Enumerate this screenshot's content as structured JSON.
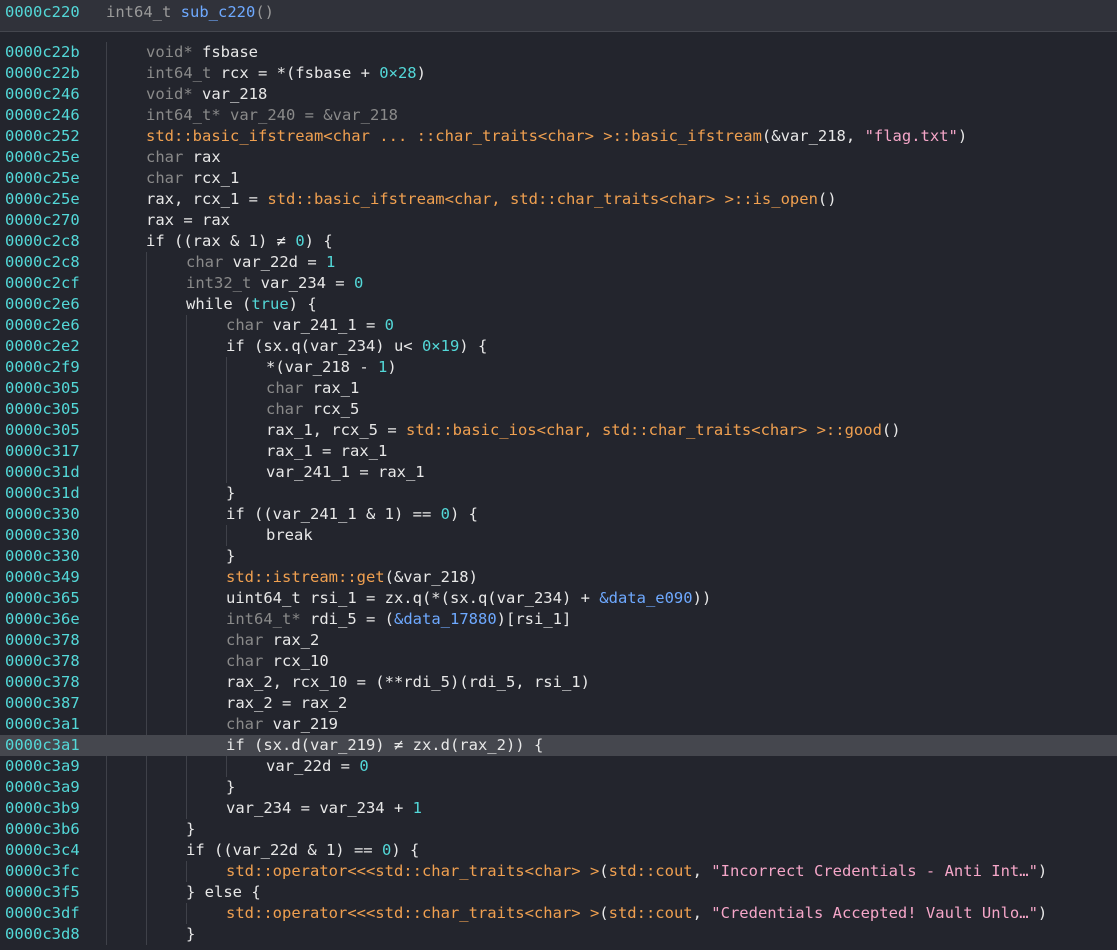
{
  "header": {
    "address": "0000c220",
    "signature_type": "int64_t ",
    "signature_name": "sub_c220",
    "signature_tail": "()"
  },
  "lines": [
    {
      "addr": "0000c22b",
      "indent": 0,
      "tokens": [
        [
          "ty",
          "void* "
        ],
        [
          "kw",
          "fsbase"
        ]
      ]
    },
    {
      "addr": "0000c22b",
      "indent": 0,
      "tokens": [
        [
          "ty",
          "int64_t "
        ],
        [
          "kw",
          "rcx = *(fsbase + "
        ],
        [
          "num",
          "0×28"
        ],
        [
          "kw",
          ")"
        ]
      ]
    },
    {
      "addr": "0000c246",
      "indent": 0,
      "tokens": [
        [
          "ty",
          "void* "
        ],
        [
          "kw",
          "var_218"
        ]
      ]
    },
    {
      "addr": "0000c246",
      "indent": 0,
      "tokens": [
        [
          "ty",
          "int64_t* var_240 = &var_218"
        ]
      ]
    },
    {
      "addr": "0000c252",
      "indent": 0,
      "tokens": [
        [
          "fn",
          "std::basic_ifstream<char ... ::char_traits<char> >::basic_ifstream"
        ],
        [
          "kw",
          "(&var_218, "
        ],
        [
          "str",
          "\"flag.txt\""
        ],
        [
          "kw",
          ")"
        ]
      ]
    },
    {
      "addr": "0000c25e",
      "indent": 0,
      "tokens": [
        [
          "ty",
          "char "
        ],
        [
          "kw",
          "rax"
        ]
      ]
    },
    {
      "addr": "0000c25e",
      "indent": 0,
      "tokens": [
        [
          "ty",
          "char "
        ],
        [
          "kw",
          "rcx_1"
        ]
      ]
    },
    {
      "addr": "0000c25e",
      "indent": 0,
      "tokens": [
        [
          "kw",
          "rax, rcx_1 = "
        ],
        [
          "fn",
          "std::basic_ifstream<char, std::char_traits<char> >::is_open"
        ],
        [
          "kw",
          "()"
        ]
      ]
    },
    {
      "addr": "0000c270",
      "indent": 0,
      "tokens": [
        [
          "kw",
          "rax = rax"
        ]
      ]
    },
    {
      "addr": "0000c2c8",
      "indent": 0,
      "tokens": [
        [
          "kw",
          "if ((rax & 1) ≠ "
        ],
        [
          "num",
          "0"
        ],
        [
          "kw",
          ") {"
        ]
      ]
    },
    {
      "addr": "0000c2c8",
      "indent": 1,
      "tokens": [
        [
          "ty",
          "char "
        ],
        [
          "kw",
          "var_22d = "
        ],
        [
          "num",
          "1"
        ]
      ]
    },
    {
      "addr": "0000c2cf",
      "indent": 1,
      "tokens": [
        [
          "ty",
          "int32_t "
        ],
        [
          "kw",
          "var_234 = "
        ],
        [
          "num",
          "0"
        ]
      ]
    },
    {
      "addr": "0000c2e6",
      "indent": 1,
      "tokens": [
        [
          "kw",
          "while ("
        ],
        [
          "bool",
          "true"
        ],
        [
          "kw",
          ") {"
        ]
      ]
    },
    {
      "addr": "0000c2e6",
      "indent": 2,
      "tokens": [
        [
          "ty",
          "char "
        ],
        [
          "kw",
          "var_241_1 = "
        ],
        [
          "num",
          "0"
        ]
      ]
    },
    {
      "addr": "0000c2e2",
      "indent": 2,
      "tokens": [
        [
          "kw",
          "if (sx.q(var_234) u< "
        ],
        [
          "num",
          "0×19"
        ],
        [
          "kw",
          ") {"
        ]
      ]
    },
    {
      "addr": "0000c2f9",
      "indent": 3,
      "tokens": [
        [
          "kw",
          "*(var_218 - "
        ],
        [
          "num",
          "1"
        ],
        [
          "kw",
          ")"
        ]
      ]
    },
    {
      "addr": "0000c305",
      "indent": 3,
      "tokens": [
        [
          "ty",
          "char "
        ],
        [
          "kw",
          "rax_1"
        ]
      ]
    },
    {
      "addr": "0000c305",
      "indent": 3,
      "tokens": [
        [
          "ty",
          "char "
        ],
        [
          "kw",
          "rcx_5"
        ]
      ]
    },
    {
      "addr": "0000c305",
      "indent": 3,
      "tokens": [
        [
          "kw",
          "rax_1, rcx_5 = "
        ],
        [
          "fn",
          "std::basic_ios<char, std::char_traits<char> >::good"
        ],
        [
          "kw",
          "()"
        ]
      ]
    },
    {
      "addr": "0000c317",
      "indent": 3,
      "tokens": [
        [
          "kw",
          "rax_1 = rax_1"
        ]
      ]
    },
    {
      "addr": "0000c31d",
      "indent": 3,
      "tokens": [
        [
          "kw",
          "var_241_1 = rax_1"
        ]
      ]
    },
    {
      "addr": "0000c31d",
      "indent": 2,
      "tokens": [
        [
          "kw",
          "}"
        ]
      ]
    },
    {
      "addr": "0000c330",
      "indent": 2,
      "tokens": [
        [
          "kw",
          "if ((var_241_1 & 1) == "
        ],
        [
          "num",
          "0"
        ],
        [
          "kw",
          ") {"
        ]
      ]
    },
    {
      "addr": "0000c330",
      "indent": 3,
      "tokens": [
        [
          "kw",
          "break"
        ]
      ]
    },
    {
      "addr": "0000c330",
      "indent": 2,
      "tokens": [
        [
          "kw",
          "}"
        ]
      ]
    },
    {
      "addr": "0000c349",
      "indent": 2,
      "tokens": [
        [
          "fn",
          "std::istream::get"
        ],
        [
          "kw",
          "(&var_218)"
        ]
      ]
    },
    {
      "addr": "0000c365",
      "indent": 2,
      "tokens": [
        [
          "kw",
          "uint64_t rsi_1 = zx.q(*(sx.q(var_234) + "
        ],
        [
          "dat",
          "&data_e090"
        ],
        [
          "kw",
          "))"
        ]
      ]
    },
    {
      "addr": "0000c36e",
      "indent": 2,
      "tokens": [
        [
          "ty",
          "int64_t* "
        ],
        [
          "kw",
          "rdi_5 = ("
        ],
        [
          "dat",
          "&data_17880"
        ],
        [
          "kw",
          ")[rsi_1]"
        ]
      ]
    },
    {
      "addr": "0000c378",
      "indent": 2,
      "tokens": [
        [
          "ty",
          "char "
        ],
        [
          "kw",
          "rax_2"
        ]
      ]
    },
    {
      "addr": "0000c378",
      "indent": 2,
      "tokens": [
        [
          "ty",
          "char "
        ],
        [
          "kw",
          "rcx_10"
        ]
      ]
    },
    {
      "addr": "0000c378",
      "indent": 2,
      "tokens": [
        [
          "kw",
          "rax_2, rcx_10 = (**rdi_5)(rdi_5, rsi_1)"
        ]
      ]
    },
    {
      "addr": "0000c387",
      "indent": 2,
      "tokens": [
        [
          "kw",
          "rax_2 = rax_2"
        ]
      ]
    },
    {
      "addr": "0000c3a1",
      "indent": 2,
      "tokens": [
        [
          "ty",
          "char "
        ],
        [
          "kw",
          "var_219"
        ]
      ]
    },
    {
      "addr": "0000c3a1",
      "indent": 2,
      "highlight": true,
      "tokens": [
        [
          "kw",
          "if (sx.d(var_219) ≠ zx.d(rax_2)) {"
        ]
      ]
    },
    {
      "addr": "0000c3a9",
      "indent": 3,
      "tokens": [
        [
          "kw",
          "var_22d = "
        ],
        [
          "num",
          "0"
        ]
      ]
    },
    {
      "addr": "0000c3a9",
      "indent": 2,
      "tokens": [
        [
          "kw",
          "}"
        ]
      ]
    },
    {
      "addr": "0000c3b9",
      "indent": 2,
      "tokens": [
        [
          "kw",
          "var_234 = var_234 + "
        ],
        [
          "num",
          "1"
        ]
      ]
    },
    {
      "addr": "0000c3b6",
      "indent": 1,
      "tokens": [
        [
          "kw",
          "}"
        ]
      ]
    },
    {
      "addr": "0000c3c4",
      "indent": 1,
      "tokens": [
        [
          "kw",
          "if ((var_22d & 1) == "
        ],
        [
          "num",
          "0"
        ],
        [
          "kw",
          ") {"
        ]
      ]
    },
    {
      "addr": "0000c3fc",
      "indent": 2,
      "tokens": [
        [
          "fn",
          "std::operator<<<std::char_traits<char> >"
        ],
        [
          "kw",
          "("
        ],
        [
          "fn",
          "std::cout"
        ],
        [
          "kw",
          ", "
        ],
        [
          "str",
          "\"Incorrect Credentials - Anti Int…\""
        ],
        [
          "kw",
          ")"
        ]
      ]
    },
    {
      "addr": "0000c3f5",
      "indent": 1,
      "tokens": [
        [
          "kw",
          "} else {"
        ]
      ]
    },
    {
      "addr": "0000c3df",
      "indent": 2,
      "tokens": [
        [
          "fn",
          "std::operator<<<std::char_traits<char> >"
        ],
        [
          "kw",
          "("
        ],
        [
          "fn",
          "std::cout"
        ],
        [
          "kw",
          ", "
        ],
        [
          "str",
          "\"Credentials Accepted! Vault Unlo…\""
        ],
        [
          "kw",
          ")"
        ]
      ]
    },
    {
      "addr": "0000c3d8",
      "indent": 1,
      "tokens": [
        [
          "kw",
          "}"
        ]
      ]
    }
  ]
}
